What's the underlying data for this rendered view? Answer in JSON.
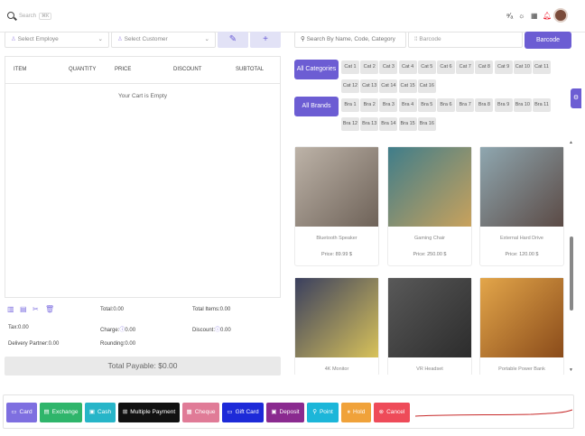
{
  "topbar": {
    "search_placeholder": "Search",
    "search_shortcut": "⌘K",
    "icons": [
      "translate-icon",
      "sun-icon",
      "qr-icon",
      "bell-icon",
      "avatar"
    ]
  },
  "controls": {
    "employee": "Select Employe",
    "customer": "Select Customer",
    "edit_icon": "✎",
    "add_icon": "+",
    "product_search": "Search By Name, Code, Category",
    "barcode_placeholder": "Barcode",
    "barcode_button": "Barcode"
  },
  "cart": {
    "columns": [
      "ITEM",
      "QUANTITY",
      "PRICE",
      "DISCOUNT",
      "SUBTOTAL"
    ],
    "empty": "Your Cart is Empty"
  },
  "summary": {
    "total": "Total:0.00",
    "total_items": "Total Items:0.00",
    "tax": "Tax:0.00",
    "charge_label": "Charge:",
    "charge_value": "0.00",
    "discount_label": "Discount:",
    "discount_value": "0.00",
    "delivery": "Delivery Partner:0.00",
    "rounding": "Rounding:0.00",
    "payable": "Total Payable: $0.00"
  },
  "categories": {
    "button": "All Categories",
    "items": [
      "Cat 1",
      "Cat 2",
      "Cat 3",
      "Cat 4",
      "Cat 5",
      "Cat 6",
      "Cat 7",
      "Cat 8",
      "Cat 9",
      "Cat 10",
      "Cat 11",
      "Cat 12",
      "Cat 13",
      "Cat 14",
      "Cat 15",
      "Cat 16"
    ]
  },
  "brands": {
    "button": "All Brands",
    "items": [
      "Bra 1",
      "Bra 2",
      "Bra 3",
      "Bra 4",
      "Bra 5",
      "Bra 6",
      "Bra 7",
      "Bra 8",
      "Bra 9",
      "Bra 10",
      "Bra 11",
      "Bra 12",
      "Bra 13",
      "Bra 14",
      "Bra 15",
      "Bra 16"
    ]
  },
  "products": [
    {
      "name": "Bluetooth Speaker",
      "price": "Price: 89.99 $",
      "colors": [
        "#bdb3a8",
        "#6e6258"
      ]
    },
    {
      "name": "Gaming Chair",
      "price": "Price: 250.00 $",
      "colors": [
        "#3f7d8a",
        "#c9a25c"
      ]
    },
    {
      "name": "External Hard Drive",
      "price": "Price: 120.00 $",
      "colors": [
        "#8fa7b0",
        "#5b4a45"
      ]
    },
    {
      "name": "4K Monitor",
      "price": "",
      "colors": [
        "#3a3f5e",
        "#d8c25a"
      ]
    },
    {
      "name": "VR Headset",
      "price": "",
      "colors": [
        "#595959",
        "#2c2c2c"
      ]
    },
    {
      "name": "Portable Power Bank",
      "price": "",
      "colors": [
        "#e3a64a",
        "#8a4b1a"
      ]
    }
  ],
  "payments": [
    {
      "label": "Card",
      "icon": "▭",
      "color": "#7e6fe0"
    },
    {
      "label": "Exchange",
      "icon": "▤",
      "color": "#2fb56b"
    },
    {
      "label": "Cash",
      "icon": "▣",
      "color": "#27b5c8"
    },
    {
      "label": "Multiple Payment",
      "icon": "⊞",
      "color": "#111111"
    },
    {
      "label": "Cheque",
      "icon": "▦",
      "color": "#e07b97"
    },
    {
      "label": "Gift Card",
      "icon": "▭",
      "color": "#1d2ad8"
    },
    {
      "label": "Deposit",
      "icon": "▣",
      "color": "#8a2a8f"
    },
    {
      "label": "Point",
      "icon": "⚲",
      "color": "#1cb6d9"
    },
    {
      "label": "Hold",
      "icon": "⏸",
      "color": "#f0a23a"
    },
    {
      "label": "Cancel",
      "icon": "⊗",
      "color": "#ee4b59"
    }
  ],
  "side_tab_icon": "⚙"
}
